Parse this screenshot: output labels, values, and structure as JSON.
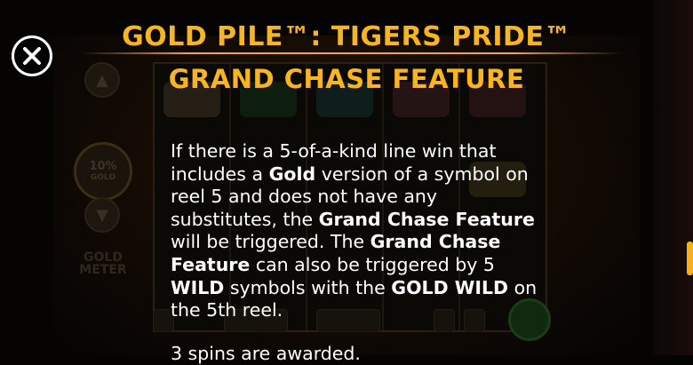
{
  "title": "GOLD PILE™: TIGERS PRIDE™",
  "subtitle": "GRAND CHASE FEATURE",
  "body": {
    "p1": [
      {
        "t": "If there is a 5-of-a-kind line win that includes a ",
        "bold": false
      },
      {
        "t": "Gold",
        "bold": true
      },
      {
        "t": " version of a symbol on reel 5 and does not have any substitutes, the ",
        "bold": false
      },
      {
        "t": "Grand Chase Feature",
        "bold": true
      },
      {
        "t": " will be triggered. The ",
        "bold": false
      },
      {
        "t": "Grand Chase Feature",
        "bold": true
      },
      {
        "t": " can also be triggered by 5 ",
        "bold": false
      },
      {
        "t": "WILD",
        "bold": true
      },
      {
        "t": " symbols with the ",
        "bold": false
      },
      {
        "t": "GOLD WILD",
        "bold": true
      },
      {
        "t": " on the 5th reel.",
        "bold": false
      }
    ],
    "p2": "3 spins are awarded."
  },
  "background": {
    "meter_percent": "10%",
    "meter_gold": "GOLD",
    "meter_label": "GOLD METER"
  },
  "colors": {
    "title": "#f9b51f",
    "text": "#ffffff",
    "background": "#050403",
    "scroll_thumb": "#f5b21c"
  },
  "icons": {
    "close": "close-icon"
  }
}
